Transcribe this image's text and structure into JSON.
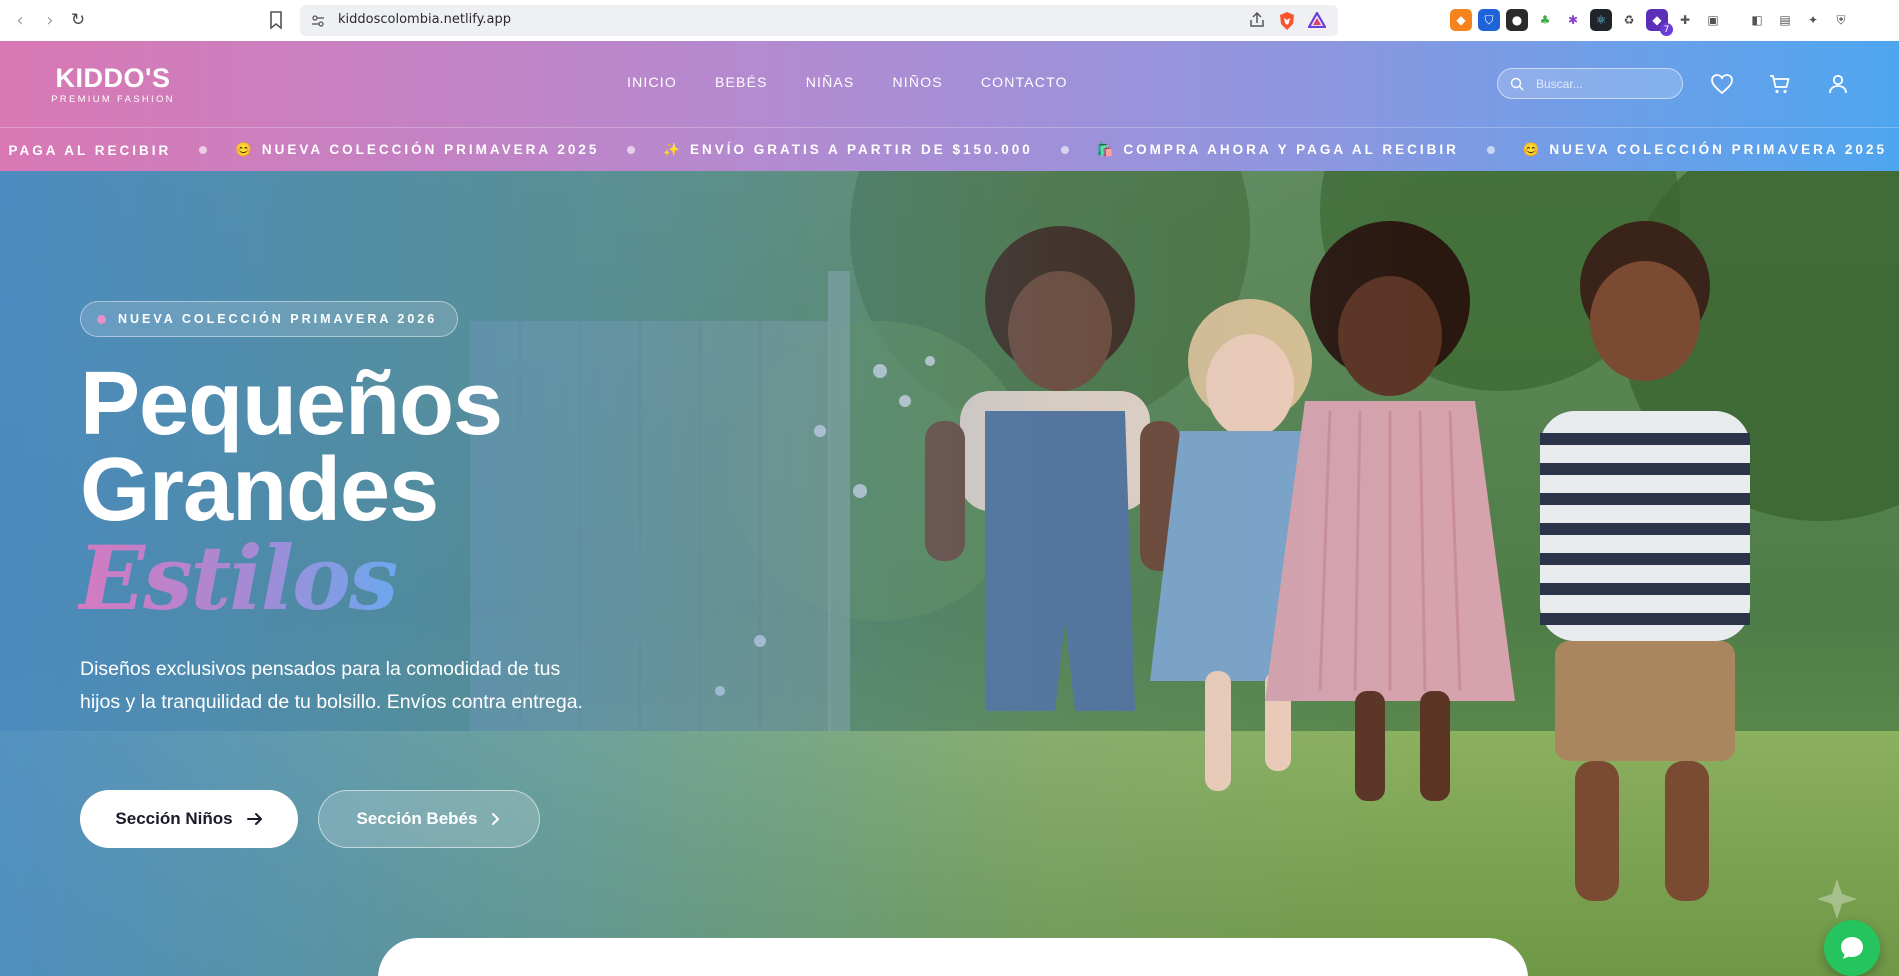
{
  "browser": {
    "url": "kiddoscolombia.netlify.app",
    "extension_badge": "7",
    "icons": [
      "back-icon",
      "forward-icon",
      "reload-icon",
      "bookmark-icon",
      "site-info-icon",
      "share-icon",
      "brave-shields-icon",
      "brave-rewards-icon"
    ]
  },
  "header": {
    "logo_main": "KIDDO'S",
    "logo_sub": "PREMIUM FASHION",
    "nav": [
      {
        "label": "INICIO"
      },
      {
        "label": "BEBÉS"
      },
      {
        "label": "NIÑAS"
      },
      {
        "label": "NIÑOS"
      },
      {
        "label": "CONTACTO"
      }
    ],
    "search_placeholder": "Buscar...",
    "icons": [
      "search-icon",
      "heart-icon",
      "cart-icon",
      "user-icon"
    ]
  },
  "ticker": [
    "Y PAGA AL RECIBIR",
    "😊 NUEVA COLECCIÓN PRIMAVERA 2025",
    "✨ ENVÍO GRATIS A PARTIR DE $150.000",
    "🛍️ COMPRA AHORA Y PAGA AL RECIBIR",
    "😊 NUEVA COLECCIÓN PRIMAVERA 2025"
  ],
  "hero": {
    "badge": "NUEVA COLECCIÓN PRIMAVERA 2026",
    "title_line1": "Pequeños",
    "title_line2": "Grandes",
    "title_accent": "Estilos",
    "description": "Diseños exclusivos pensados para la comodidad de tus hijos y la tranquilidad de tu bolsillo. Envíos contra entrega.",
    "primary_button": "Sección Niños",
    "secondary_button": "Sección Bebés"
  },
  "colors": {
    "header_gradient_start": "#d978b4",
    "header_gradient_end": "#4ea6ef",
    "accent_pink": "#d47ac0",
    "accent_blue": "#6ba8ef",
    "chat_green": "#25c45e"
  }
}
